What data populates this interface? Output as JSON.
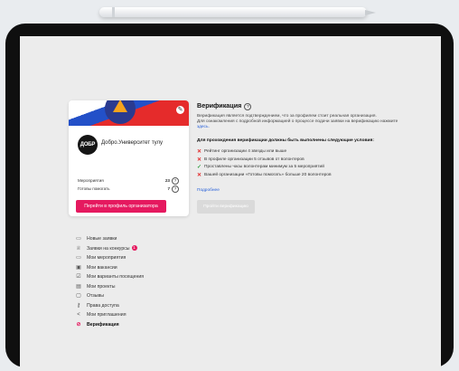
{
  "org_card": {
    "name": "Добро.Университет тулу",
    "logo_text": "ДОБР",
    "stats": [
      {
        "label": "Мероприятия",
        "value": "23"
      },
      {
        "label": "Готовы помогать",
        "value": "7"
      }
    ],
    "profile_button": "Перейти в профиль организатора"
  },
  "menu": {
    "items": [
      {
        "label": "Новые заявки",
        "icon": "calendar-icon",
        "glyph": "▭"
      },
      {
        "label": "Заявки на конкурсы",
        "icon": "trophy-icon",
        "glyph": "♕",
        "badge": "1"
      },
      {
        "label": "Мои мероприятия",
        "icon": "calendar-icon",
        "glyph": "▭"
      },
      {
        "label": "Мои вакансии",
        "icon": "vacancy-icon",
        "glyph": "▣"
      },
      {
        "label": "Мои варианты посещения",
        "icon": "checklist-icon",
        "glyph": "☑"
      },
      {
        "label": "Мои проекты",
        "icon": "projects-icon",
        "glyph": "▤"
      },
      {
        "label": "Отзывы",
        "icon": "comment-icon",
        "glyph": "▢"
      },
      {
        "label": "Права доступа",
        "icon": "key-icon",
        "glyph": "⚷"
      },
      {
        "label": "Мои приглашения",
        "icon": "share-icon",
        "glyph": "<"
      },
      {
        "label": "Верификация",
        "icon": "verification-icon",
        "glyph": "⊘",
        "active": true
      }
    ]
  },
  "verification": {
    "title": "Верификация",
    "desc_line1": "Верификация является подтверждением, что за профилем стоит реальная организация.",
    "desc_line2": "Для ознакомления с подробной информацией о процессе подачи заявки на верификацию нажмите",
    "desc_link": "здесь.",
    "requirements_title": "Для прохождения верификации должны быть выполнены следующие условия:",
    "conditions": [
      {
        "text": "Рейтинг организации 4 звезды или выше",
        "met": false
      },
      {
        "text": "В профиле организации 5 отзывов от волонтеров",
        "met": false
      },
      {
        "text": "Проставлены часы волонтерам минимум за 5 мероприятий",
        "met": true
      },
      {
        "text": "Вашей организации «Готовы помогать» больше 20 волонтеров",
        "met": false
      }
    ],
    "more_link": "Подробнее",
    "submit_button": "Пройти верификацию"
  },
  "colors": {
    "accent": "#e5195f",
    "link": "#2a62d9",
    "fail": "#e22b2b",
    "ok": "#2e9e3e"
  }
}
